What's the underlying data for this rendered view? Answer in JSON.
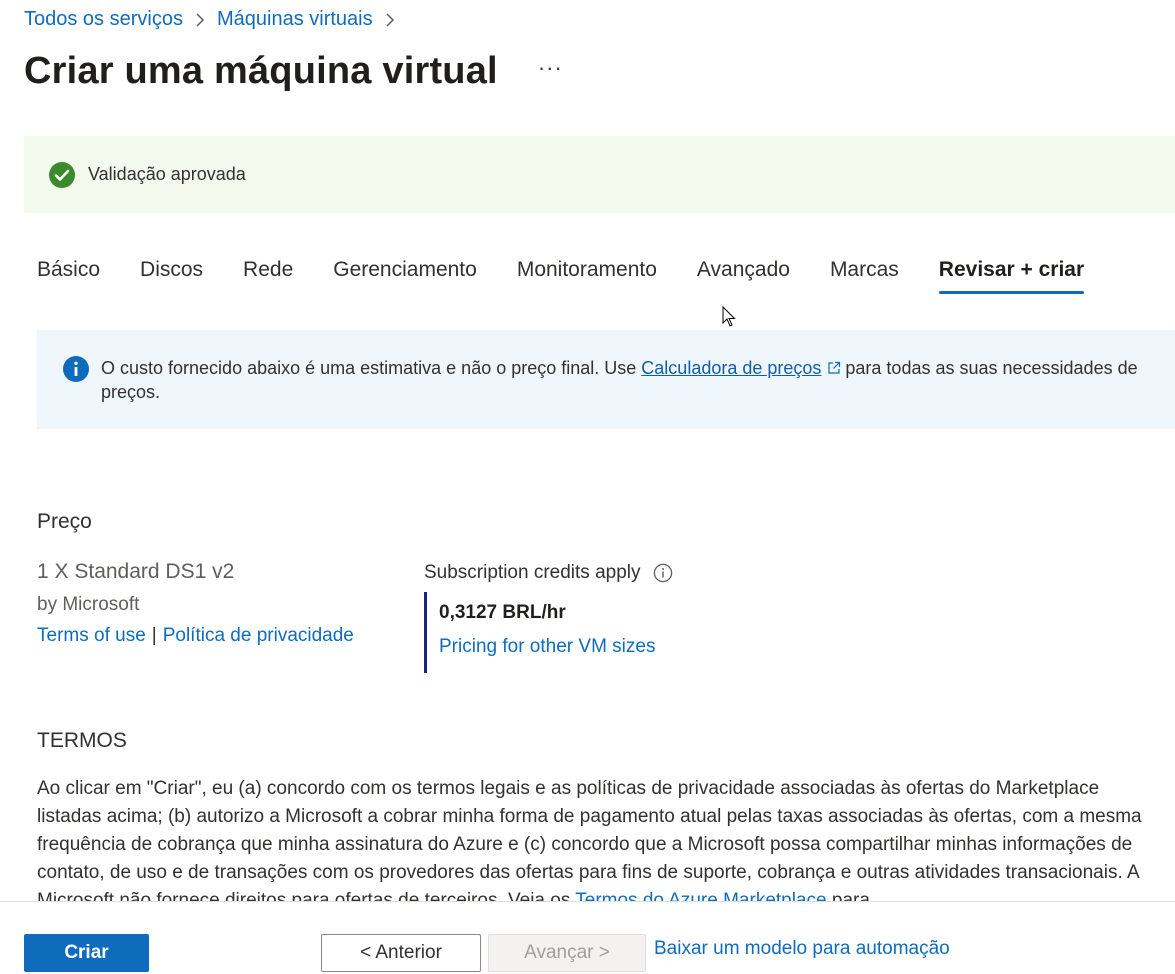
{
  "breadcrumb": {
    "items": [
      "Todos os serviços",
      "Máquinas virtuais"
    ]
  },
  "header": {
    "title": "Criar uma máquina virtual",
    "more": "···"
  },
  "validation": {
    "message": "Validação aprovada",
    "color": "#3c8a2e"
  },
  "tabs": [
    {
      "label": "Básico"
    },
    {
      "label": "Discos"
    },
    {
      "label": "Rede"
    },
    {
      "label": "Gerenciamento"
    },
    {
      "label": "Monitoramento"
    },
    {
      "label": "Avançado"
    },
    {
      "label": "Marcas"
    },
    {
      "label": "Revisar + criar",
      "active": true
    }
  ],
  "info": {
    "text_before": "O custo fornecido abaixo é uma estimativa e não o preço final. Use ",
    "link": "Calculadora de preços",
    "text_after": "para todas as suas necessidades de preços.",
    "icon_color": "#0f6cbd"
  },
  "pricing": {
    "title": "Preço",
    "offer_name": "1 X Standard DS1 v2",
    "publisher": "by Microsoft",
    "terms_link": "Terms of use",
    "separator": "|",
    "privacy_link": "Política de privacidade",
    "credits": "Subscription credits apply",
    "price": "0,3127 BRL/hr",
    "other_sizes_link": "Pricing for other VM sizes"
  },
  "terms": {
    "title": "TERMOS",
    "text": "Ao clicar em \"Criar\", eu (a) concordo com os termos legais e as políticas de privacidade associadas às ofertas do Marketplace listadas acima; (b) autorizo a Microsoft a cobrar minha forma de pagamento atual pelas taxas associadas às ofertas, com a mesma frequência de cobrança que minha assinatura do Azure e (c) concordo que a Microsoft possa compartilhar minhas informações de contato, de uso e de transações com os provedores das ofertas para fins de suporte, cobrança e outras atividades transacionais. A Microsoft não fornece direitos para ofertas de terceiros. Veja os ",
    "link": "Termos do Azure Marketplace",
    "text_after": " para"
  },
  "footer": {
    "create": "Criar",
    "previous": "< Anterior",
    "next": "Avançar >",
    "download": "Baixar um modelo para automação"
  },
  "colors": {
    "accent": "#0f6cbd",
    "success_bg": "#f3f9ec",
    "info_bg": "#eff6fc",
    "price_bar": "#1a237e"
  }
}
